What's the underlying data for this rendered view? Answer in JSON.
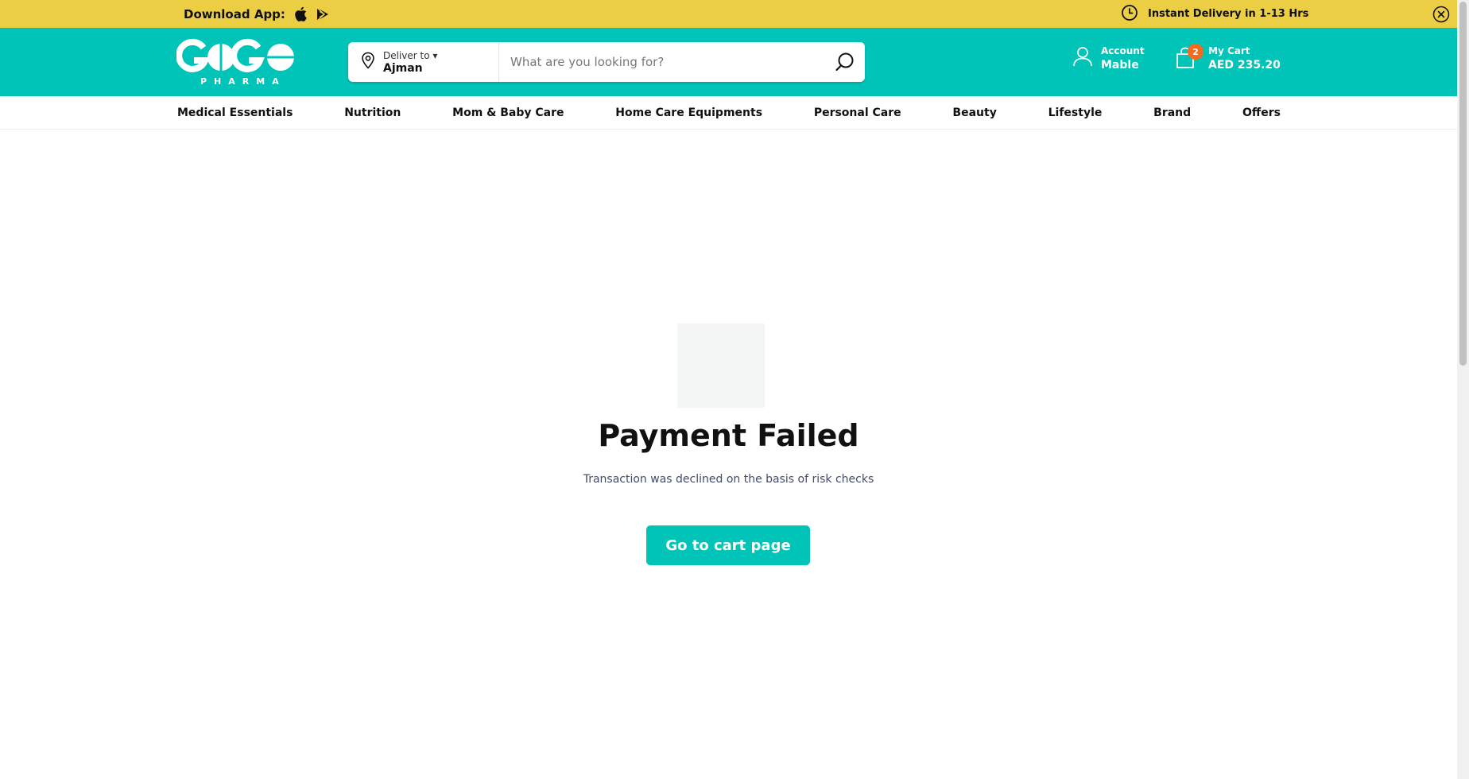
{
  "banner": {
    "download_label": "Download App:",
    "apple_icon": "apple-icon",
    "play_icon": "google-play-icon",
    "delivery_text": "Instant Delivery in 1-13 Hrs",
    "clock_icon": "clock-icon",
    "close_icon": "close-icon",
    "color": "#ecce45"
  },
  "header": {
    "brand_color": "#00c4b8",
    "logo_text": "GOGO",
    "logo_sub": "PHARMA",
    "deliver_label": "Deliver to ▾",
    "deliver_city": "Ajman",
    "search_placeholder": "What are you looking for?",
    "account_label": "Account",
    "account_name": "Mable",
    "cart_label": "My Cart",
    "cart_total": "AED 235.20",
    "cart_count": "2",
    "badge_color": "#f36b1c"
  },
  "nav": {
    "items": [
      "Medical Essentials",
      "Nutrition",
      "Mom & Baby Care",
      "Home Care Equipments",
      "Personal Care",
      "Beauty",
      "Lifestyle",
      "Brand",
      "Offers"
    ]
  },
  "main": {
    "title": "Payment Failed",
    "message": "Transaction was declined on the basis of risk checks",
    "cta_label": "Go to cart page"
  }
}
